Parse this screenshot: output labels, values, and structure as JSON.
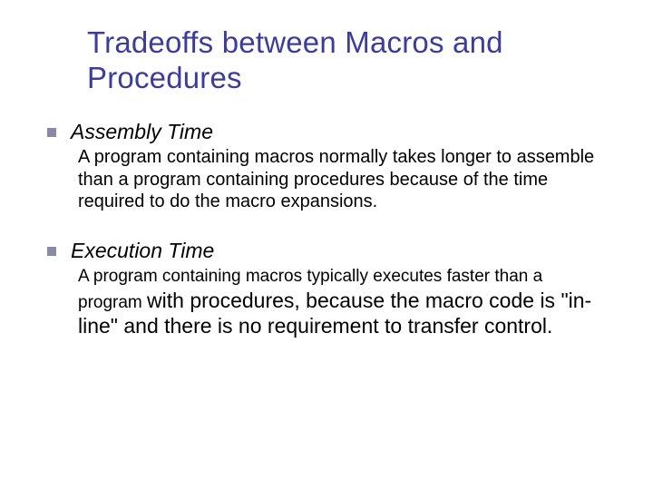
{
  "title": "Tradeoffs between Macros and Procedures",
  "points": [
    {
      "head": "Assembly Time",
      "body": "A program containing macros normally takes longer to assemble than a program containing procedures because of the time required to do the macro expansions."
    },
    {
      "head": "Execution Time",
      "body_small": "A program containing macros typically executes faster than a program ",
      "body_large": "with procedures, because the macro code is \"in-line\" and there is no requirement to transfer control."
    }
  ]
}
